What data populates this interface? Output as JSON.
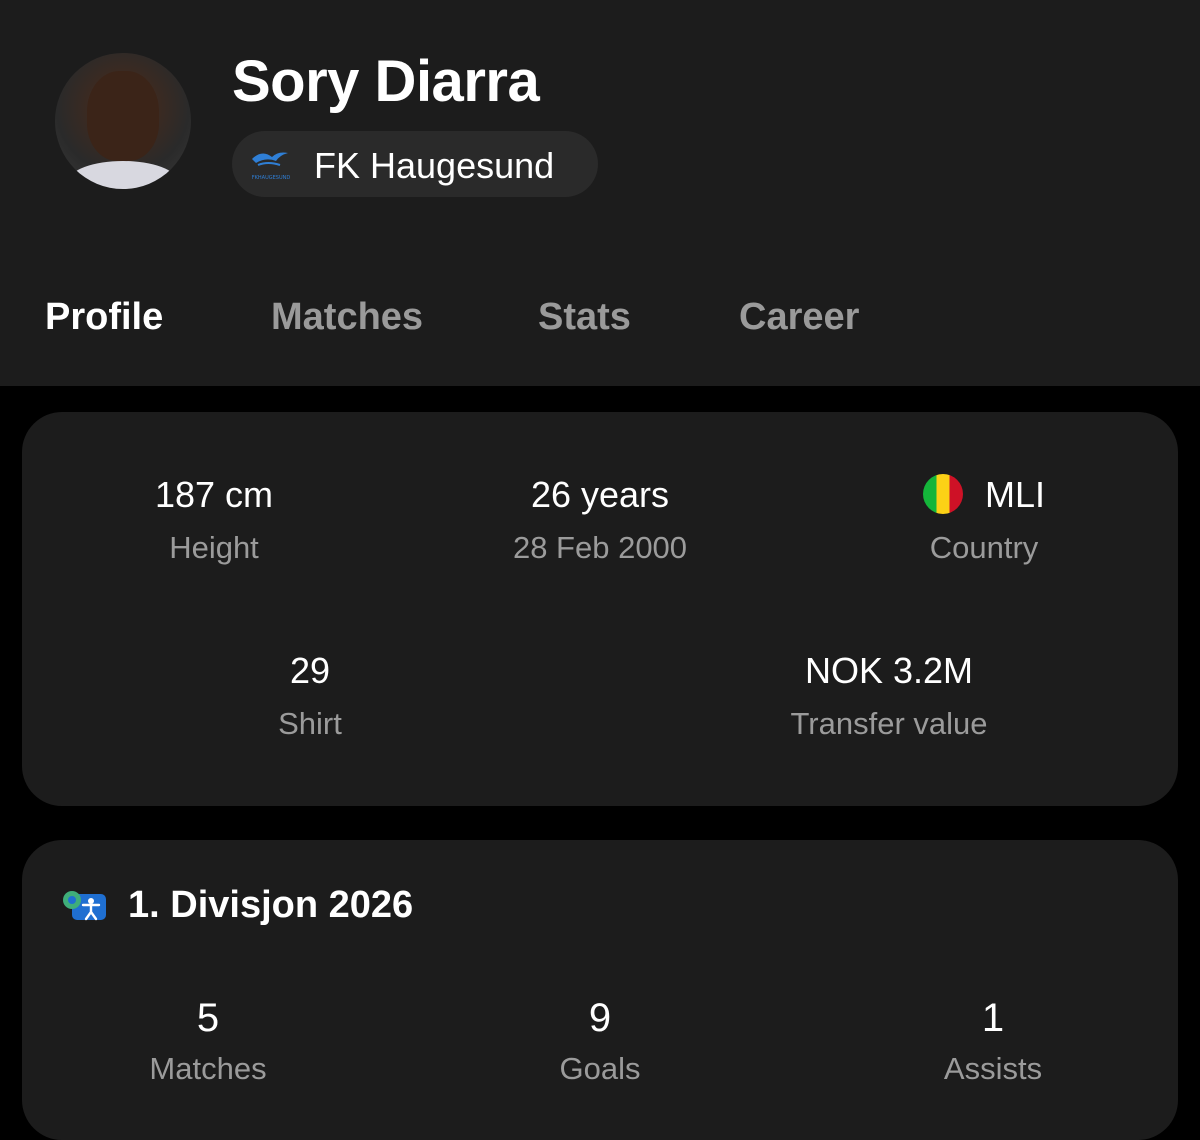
{
  "player": {
    "name": "Sory Diarra",
    "club": "FK Haugesund",
    "club_logo_text": "FKHAUGESUND"
  },
  "tabs": [
    {
      "label": "Profile",
      "active": true
    },
    {
      "label": "Matches",
      "active": false
    },
    {
      "label": "Stats",
      "active": false
    },
    {
      "label": "Career",
      "active": false
    }
  ],
  "info": {
    "height": {
      "value": "187 cm",
      "label": "Height"
    },
    "age": {
      "value": "26 years",
      "label": "28 Feb 2000"
    },
    "country": {
      "value": "MLI",
      "label": "Country",
      "flag_icon": "mali-flag-icon",
      "flag_colors": [
        "#14b53a",
        "#fcd116",
        "#ce1126"
      ]
    },
    "shirt": {
      "value": "29",
      "label": "Shirt"
    },
    "transfer": {
      "value": "NOK 3.2M",
      "label": "Transfer value"
    }
  },
  "league": {
    "icon": "league-icon",
    "title": "1. Divisjon 2026",
    "stats": [
      {
        "value": "5",
        "label": "Matches"
      },
      {
        "value": "9",
        "label": "Goals"
      },
      {
        "value": "1",
        "label": "Assists"
      }
    ]
  },
  "colors": {
    "background": "#000000",
    "surface": "#1c1c1c",
    "chip": "#2a2a2a",
    "text_primary": "#ffffff",
    "text_secondary": "#9b9b9b"
  }
}
